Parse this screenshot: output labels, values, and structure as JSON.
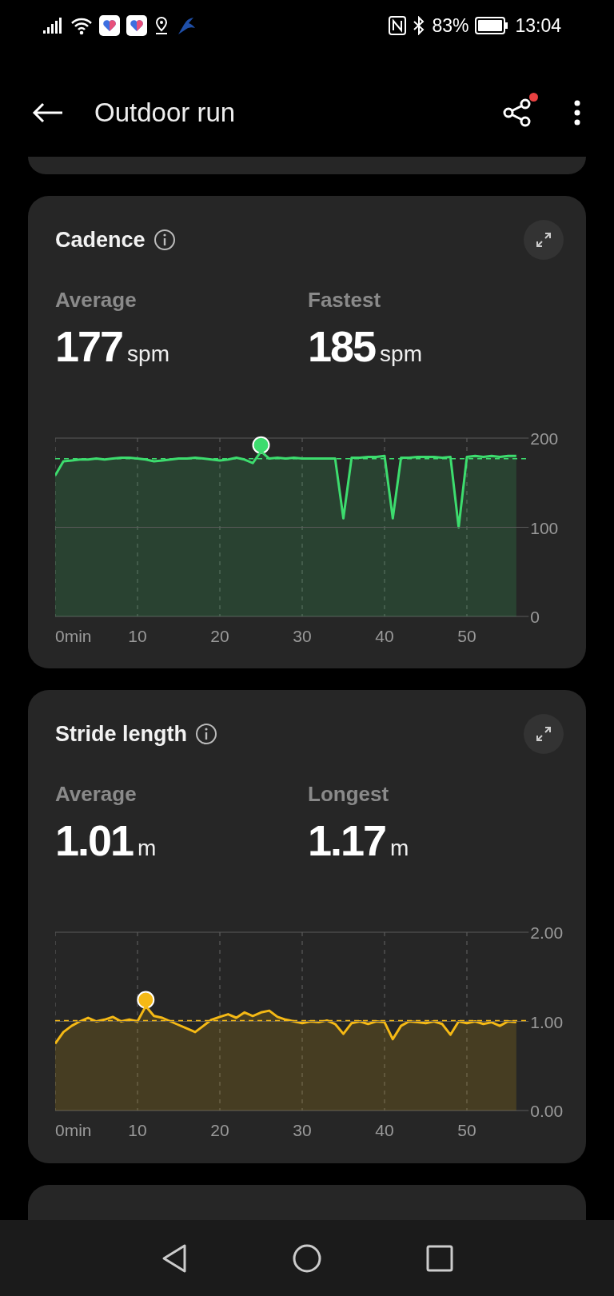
{
  "status_bar": {
    "battery": "83%",
    "time": "13:04"
  },
  "header": {
    "title": "Outdoor run",
    "share_badge": true
  },
  "cards": [
    {
      "stats": [
        {
          "label": "Average",
          "value": "177",
          "unit": "spm"
        },
        {
          "label": "Fastest",
          "value": "185",
          "unit": "spm"
        }
      ],
      "chart_data": {
        "type": "area",
        "xlim": [
          0,
          57.5
        ],
        "ylim": [
          0,
          200
        ],
        "xticks": [
          {
            "value": 0,
            "label": "0min"
          },
          10,
          20,
          30,
          40,
          50
        ],
        "yticks": [
          {
            "value": 0,
            "label": "0"
          },
          {
            "value": 100,
            "label": "100"
          },
          {
            "value": 200,
            "label": "200"
          }
        ],
        "x": [
          0,
          1,
          2,
          3,
          4,
          5,
          6,
          7,
          8,
          9,
          10,
          11,
          12,
          13,
          14,
          15,
          16,
          17,
          18,
          19,
          20,
          21,
          22,
          23,
          24,
          25,
          26,
          27,
          28,
          29,
          30,
          31,
          32,
          33,
          34,
          35,
          36,
          37,
          38,
          39,
          40,
          41,
          42,
          43,
          44,
          45,
          46,
          47,
          48,
          49,
          50,
          51,
          52,
          53,
          54,
          55,
          56
        ],
        "grid": true,
        "ref_lines": [
          {
            "axis": "y",
            "value": 100
          },
          {
            "axis": "y",
            "value": 177
          }
        ],
        "series": [
          {
            "name": "Cadence",
            "color": "#3ddc6e",
            "values": [
              158,
              174,
              175,
              176,
              176,
              177,
              176,
              177,
              178,
              178,
              177,
              176,
              174,
              175,
              176,
              177,
              177,
              178,
              177,
              176,
              175,
              176,
              178,
              176,
              172,
              185,
              177,
              178,
              177,
              178,
              177,
              177,
              177,
              177,
              177,
              110,
              178,
              178,
              179,
              179,
              180,
              110,
              178,
              178,
              179,
              179,
              179,
              178,
              179,
              100,
              179,
              180,
              179,
              180,
              179,
              180,
              180
            ]
          }
        ]
      }
    },
    {
      "stats": [
        {
          "label": "Average",
          "value": "1.01",
          "unit": "m"
        },
        {
          "label": "Longest",
          "value": "1.17",
          "unit": "m"
        }
      ],
      "chart_data": {
        "type": "area",
        "xlim": [
          0,
          57.5
        ],
        "ylim": [
          0,
          2
        ],
        "xticks": [
          {
            "value": 0,
            "label": "0min"
          },
          10,
          20,
          30,
          40,
          50
        ],
        "yticks": [
          {
            "value": 0,
            "label": "0.00"
          },
          {
            "value": 1,
            "label": "1.00"
          },
          {
            "value": 2,
            "label": "2.00"
          }
        ],
        "x": [
          0,
          1,
          2,
          3,
          4,
          5,
          6,
          7,
          8,
          9,
          10,
          11,
          12,
          13,
          14,
          15,
          16,
          17,
          18,
          19,
          20,
          21,
          22,
          23,
          24,
          25,
          26,
          27,
          28,
          29,
          30,
          31,
          32,
          33,
          34,
          35,
          36,
          37,
          38,
          39,
          40,
          41,
          42,
          43,
          44,
          45,
          46,
          47,
          48,
          49,
          50,
          51,
          52,
          53,
          54,
          55,
          56
        ],
        "grid": true,
        "ref_lines": [
          {
            "axis": "y",
            "value": 1
          },
          {
            "axis": "y",
            "value": 1.01
          }
        ],
        "series": [
          {
            "name": "Stride length",
            "color": "#f5b915",
            "values": [
              0.75,
              0.88,
              0.95,
              1.0,
              1.04,
              1.0,
              1.02,
              1.05,
              1.0,
              1.02,
              1.0,
              1.17,
              1.06,
              1.04,
              1.0,
              0.96,
              0.92,
              0.88,
              0.95,
              1.02,
              1.05,
              1.08,
              1.04,
              1.1,
              1.06,
              1.1,
              1.12,
              1.05,
              1.02,
              1.0,
              0.98,
              1.0,
              0.99,
              1.01,
              0.97,
              0.86,
              0.98,
              1.0,
              0.97,
              1.0,
              0.99,
              0.8,
              0.95,
              1.0,
              0.99,
              0.98,
              1.0,
              0.97,
              0.85,
              1.0,
              0.98,
              1.0,
              0.97,
              0.99,
              0.95,
              1.0,
              0.99
            ]
          }
        ]
      }
    }
  ]
}
